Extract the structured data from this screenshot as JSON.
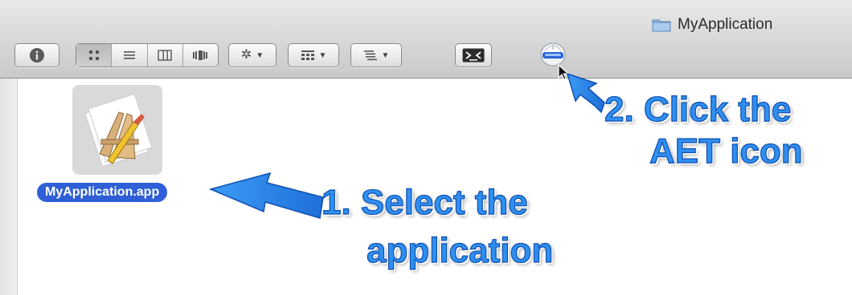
{
  "window": {
    "title": "MyApplication"
  },
  "toolbar": {
    "info_icon": "info-icon",
    "view_modes": [
      "icon-view",
      "list-view",
      "column-view",
      "coverflow-view"
    ],
    "active_view": "icon-view",
    "action_icon": "gear-icon",
    "arrange_icon": "arrange-icon",
    "sort_icon": "sort-icon",
    "terminal_icon": "terminal-icon",
    "aet_icon": "aet-helmet-icon"
  },
  "file": {
    "name": "MyApplication.app",
    "icon": "xcode-app-icon",
    "selected": true
  },
  "callouts": {
    "step2_line1": "2. Click the",
    "step2_line2": "AET icon",
    "step1_line1": "1. Select the",
    "step1_line2": "application"
  },
  "colors": {
    "callout_text": "#2f8ff0",
    "callout_outline": "#0f4fb0",
    "selection": "#2f5fd6",
    "toolbar": "#d7d7d7"
  }
}
